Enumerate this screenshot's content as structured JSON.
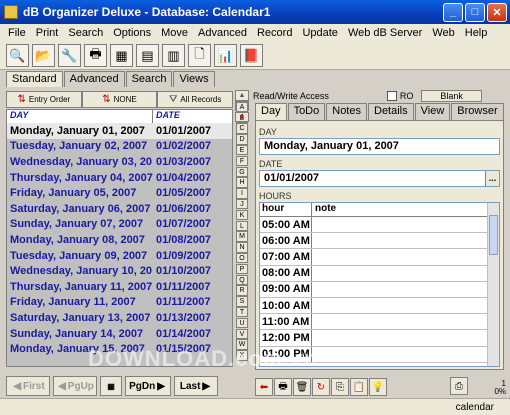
{
  "window": {
    "title": "dB Organizer Deluxe - Database: Calendar1"
  },
  "menu": [
    "File",
    "Print",
    "Search",
    "Options",
    "Move",
    "Advanced",
    "Record",
    "Update",
    "Web dB Server",
    "Web",
    "Help"
  ],
  "left_tabs": [
    "Standard",
    "Advanced",
    "Search",
    "Views"
  ],
  "sort": {
    "entry_order": "Entry Order",
    "none": "NONE",
    "all_records": "All Records"
  },
  "list": {
    "headers": [
      "DAY",
      "DATE"
    ],
    "rows": [
      [
        "Monday, January 01, 2007",
        "01/01/2007"
      ],
      [
        "Tuesday, January 02, 2007",
        "01/02/2007"
      ],
      [
        "Wednesday, January 03, 20",
        "01/03/2007"
      ],
      [
        "Thursday, January 04, 2007",
        "01/04/2007"
      ],
      [
        "Friday, January 05, 2007",
        "01/05/2007"
      ],
      [
        "Saturday, January 06, 2007",
        "01/06/2007"
      ],
      [
        "Sunday, January 07, 2007",
        "01/07/2007"
      ],
      [
        "Monday, January 08, 2007",
        "01/08/2007"
      ],
      [
        "Tuesday, January 09, 2007",
        "01/09/2007"
      ],
      [
        "Wednesday, January 10, 20",
        "01/10/2007"
      ],
      [
        "Thursday, January 11, 2007",
        "01/11/2007"
      ],
      [
        "Friday, January 11, 2007",
        "01/11/2007"
      ],
      [
        "Saturday, January 13, 2007",
        "01/13/2007"
      ],
      [
        "Sunday, January 14, 2007",
        "01/14/2007"
      ],
      [
        "Monday, January 15, 2007",
        "01/15/2007"
      ]
    ]
  },
  "nav": {
    "first": "First",
    "pgup": "PgUp",
    "pgdn": "PgDn",
    "last": "Last"
  },
  "alphabet": [
    "A",
    "B",
    "C",
    "D",
    "E",
    "F",
    "G",
    "H",
    "I",
    "J",
    "K",
    "L",
    "M",
    "N",
    "O",
    "P",
    "Q",
    "R",
    "S",
    "T",
    "U",
    "V",
    "W",
    "X"
  ],
  "access": {
    "label": "Read/Write Access",
    "ro": "RO",
    "blank": "Blank"
  },
  "right_tabs": [
    "Day",
    "ToDo",
    "Notes",
    "Details",
    "View",
    "Browser"
  ],
  "fields": {
    "day_label": "DAY",
    "day_value": "Monday, January 01, 2007",
    "date_label": "DATE",
    "date_value": "01/01/2007",
    "date_btn": "...",
    "hours_label": "HOURS"
  },
  "hours": {
    "headers": [
      "hour",
      "note"
    ],
    "rows": [
      "05:00 AM",
      "06:00 AM",
      "07:00 AM",
      "08:00 AM",
      "09:00 AM",
      "10:00 AM",
      "11:00 AM",
      "12:00 PM",
      "01:00 PM"
    ]
  },
  "status": {
    "text": "calendar",
    "pct_top": "1",
    "pct_bottom": "0%"
  },
  "watermark": "DOWNLOAD.com.vn",
  "colors": {
    "list_text": "#1a1aa0",
    "titlebar": "#0a4fd0"
  }
}
